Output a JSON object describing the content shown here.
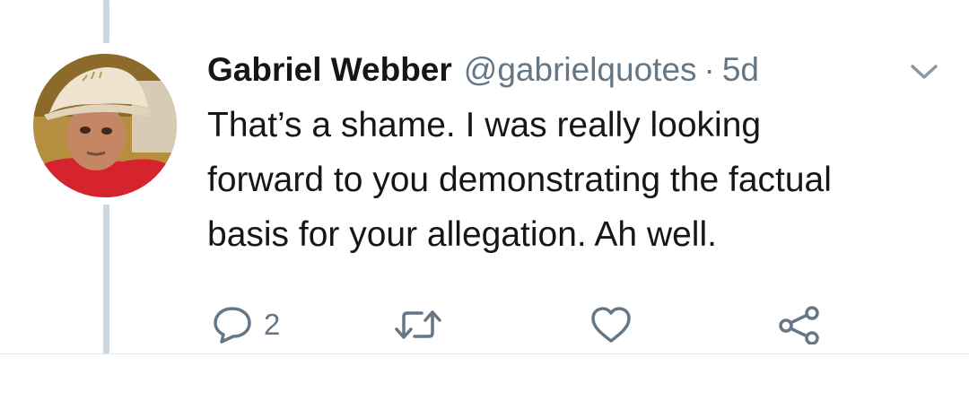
{
  "tweet": {
    "author_name": "Gabriel Webber",
    "handle": "@gabrielquotes",
    "separator": "·",
    "time_ago": "5d",
    "text": "That’s a shame. I was really looking\nforward to you demonstrating the factual\nbasis for your allegation. Ah well.",
    "avatar": "profile-photo"
  },
  "actions": {
    "reply_icon": "comment-icon",
    "reply_count": "2",
    "retweet_icon": "retweet-icon",
    "like_icon": "heart-icon",
    "share_icon": "share-icon"
  },
  "colors": {
    "text": "#14171a",
    "secondary": "#657786",
    "thread_line": "#ccd6dd",
    "divider": "#e1e8ed"
  }
}
